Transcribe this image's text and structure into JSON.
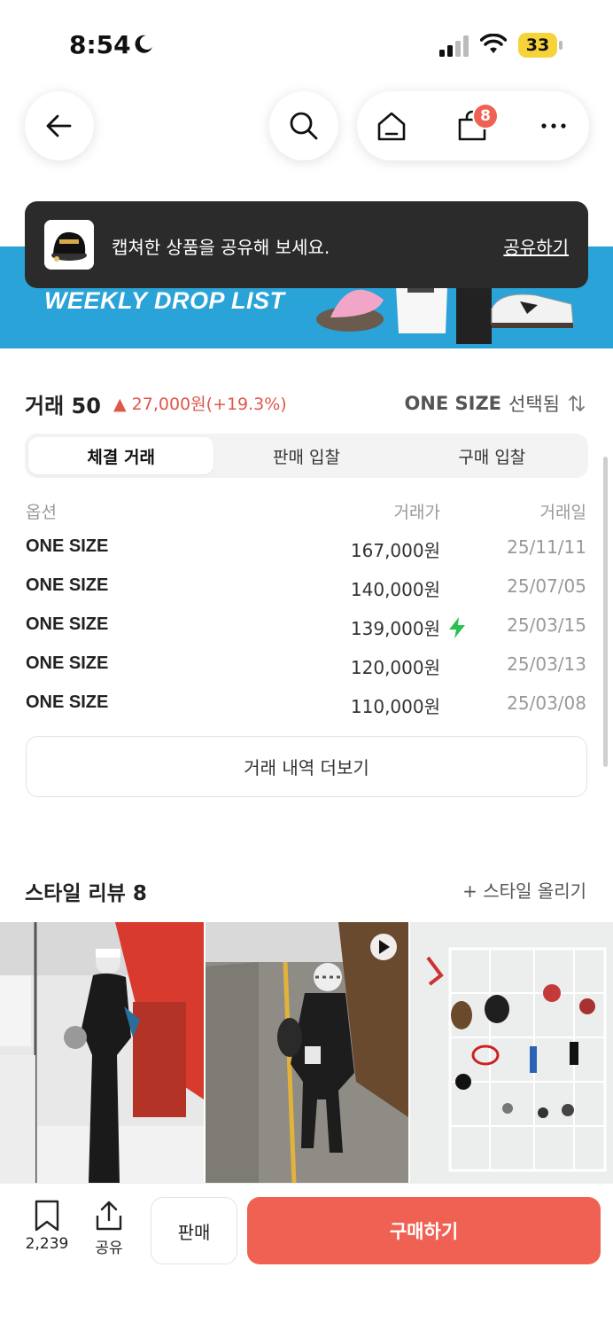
{
  "status_bar": {
    "time": "8:54",
    "battery": "33"
  },
  "nav": {
    "cart_count": "8"
  },
  "banner": {
    "text": "WEEKLY DROP LIST"
  },
  "toast": {
    "message": "캡쳐한 상품을 공유해 보세요.",
    "action": "공유하기"
  },
  "trade": {
    "title": "거래 50",
    "change": "▲ 27,000원(+19.3%)",
    "size_label": "ONE SIZE",
    "size_suffix": "선택됨",
    "tabs": [
      "체결 거래",
      "판매 입찰",
      "구매 입찰"
    ],
    "columns": [
      "옵션",
      "거래가",
      "거래일"
    ],
    "rows": [
      {
        "option": "ONE SIZE",
        "price": "167,000원",
        "date": "25/11/11"
      },
      {
        "option": "ONE SIZE",
        "price": "140,000원",
        "date": "25/07/05"
      },
      {
        "option": "ONE SIZE",
        "price": "139,000원",
        "date": "25/03/15",
        "quick": true
      },
      {
        "option": "ONE SIZE",
        "price": "120,000원",
        "date": "25/03/13"
      },
      {
        "option": "ONE SIZE",
        "price": "110,000원",
        "date": "25/03/08"
      }
    ],
    "more_label": "거래 내역 더보기"
  },
  "style": {
    "title": "스타일 리뷰 8",
    "upload_label": "+ 스타일 올리기"
  },
  "bottom": {
    "bookmark_count": "2,239",
    "share_label": "공유",
    "sell_label": "판매",
    "buy_label": "구매하기"
  },
  "colors": {
    "accent": "#ef6253",
    "banner": "#2aa3d8",
    "toast": "#2b2b2b",
    "quick": "#2cc14f"
  }
}
